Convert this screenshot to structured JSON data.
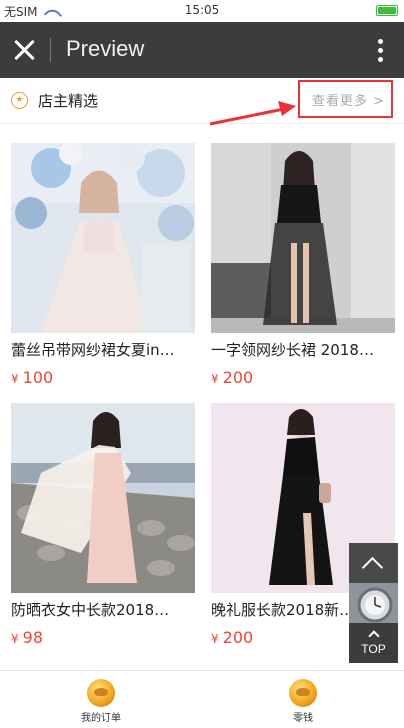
{
  "status_bar": {
    "carrier": "无SIM",
    "time": "15:05"
  },
  "title_bar": {
    "title": "Preview"
  },
  "section": {
    "title": "店主精选",
    "see_more": "查看更多 >"
  },
  "products": [
    {
      "name": "蕾丝吊带网纱裙女夏in…",
      "currency": "¥",
      "price": "100"
    },
    {
      "name": "一字领网纱长裙 2018…",
      "currency": "¥",
      "price": "200"
    },
    {
      "name": "防晒衣女中长款2018…",
      "currency": "¥",
      "price": "98"
    },
    {
      "name": "晚礼服长款2018新…",
      "currency": "¥",
      "price": "200"
    }
  ],
  "float_buttons": {
    "top_label": "TOP"
  },
  "bottom_tabs": [
    {
      "label": "我的订单",
      "icon": "gold-ingot-icon"
    },
    {
      "label": "零钱",
      "icon": "gold-ingot-icon"
    }
  ],
  "colors": {
    "title_bar_bg": "#3c3c3c",
    "price": "#e8473a",
    "highlight_box": "#e8323a",
    "star_icon": "#f39b2c"
  }
}
